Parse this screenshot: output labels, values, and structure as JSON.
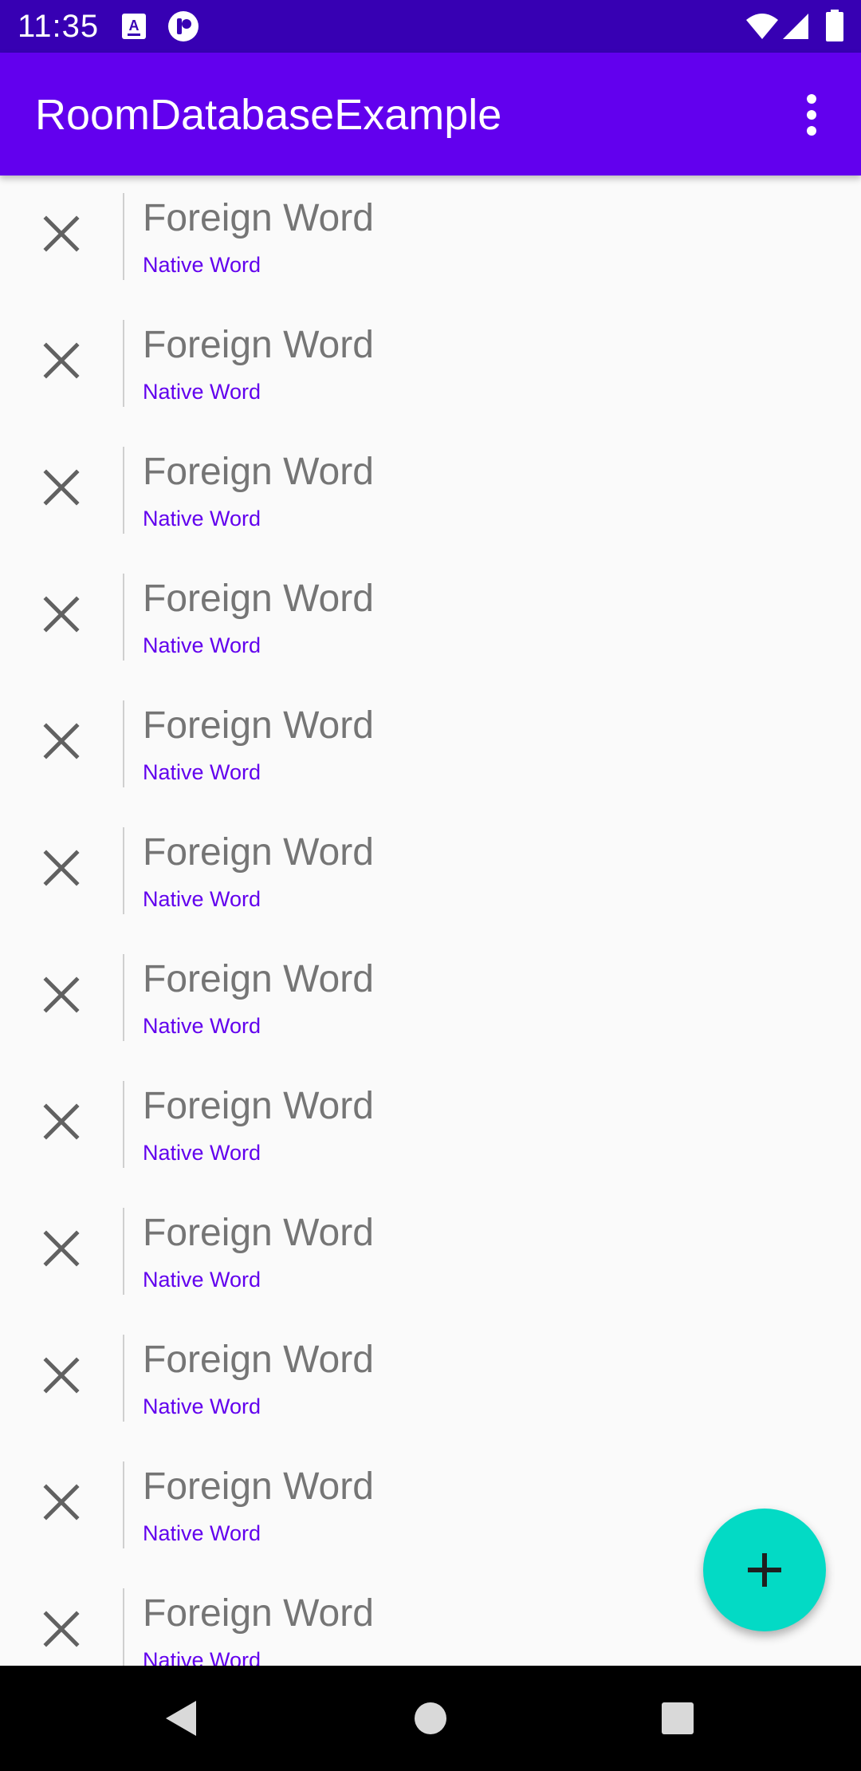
{
  "status_bar": {
    "time": "11:35",
    "icons": [
      "keyboard-a-icon",
      "app-notification-icon",
      "wifi-icon",
      "signal-icon",
      "battery-icon"
    ]
  },
  "app_bar": {
    "title": "RoomDatabaseExample",
    "overflow_icon": "more-vert-icon"
  },
  "list": {
    "items": [
      {
        "foreign": "Foreign Word",
        "native": "Native Word"
      },
      {
        "foreign": "Foreign Word",
        "native": "Native Word"
      },
      {
        "foreign": "Foreign Word",
        "native": "Native Word"
      },
      {
        "foreign": "Foreign Word",
        "native": "Native Word"
      },
      {
        "foreign": "Foreign Word",
        "native": "Native Word"
      },
      {
        "foreign": "Foreign Word",
        "native": "Native Word"
      },
      {
        "foreign": "Foreign Word",
        "native": "Native Word"
      },
      {
        "foreign": "Foreign Word",
        "native": "Native Word"
      },
      {
        "foreign": "Foreign Word",
        "native": "Native Word"
      },
      {
        "foreign": "Foreign Word",
        "native": "Native Word"
      },
      {
        "foreign": "Foreign Word",
        "native": "Native Word"
      },
      {
        "foreign": "Foreign Word",
        "native": "Native Word"
      }
    ],
    "delete_icon": "close-icon"
  },
  "fab": {
    "icon": "add-icon"
  },
  "nav_bar": {
    "icons": [
      "back-icon",
      "home-icon",
      "recents-icon"
    ]
  },
  "colors": {
    "status_bar": "#3700b3",
    "app_bar": "#6200ee",
    "accent": "#03dac5",
    "foreign_text": "#757575",
    "native_text": "#6200ee",
    "background": "#fafafa"
  }
}
